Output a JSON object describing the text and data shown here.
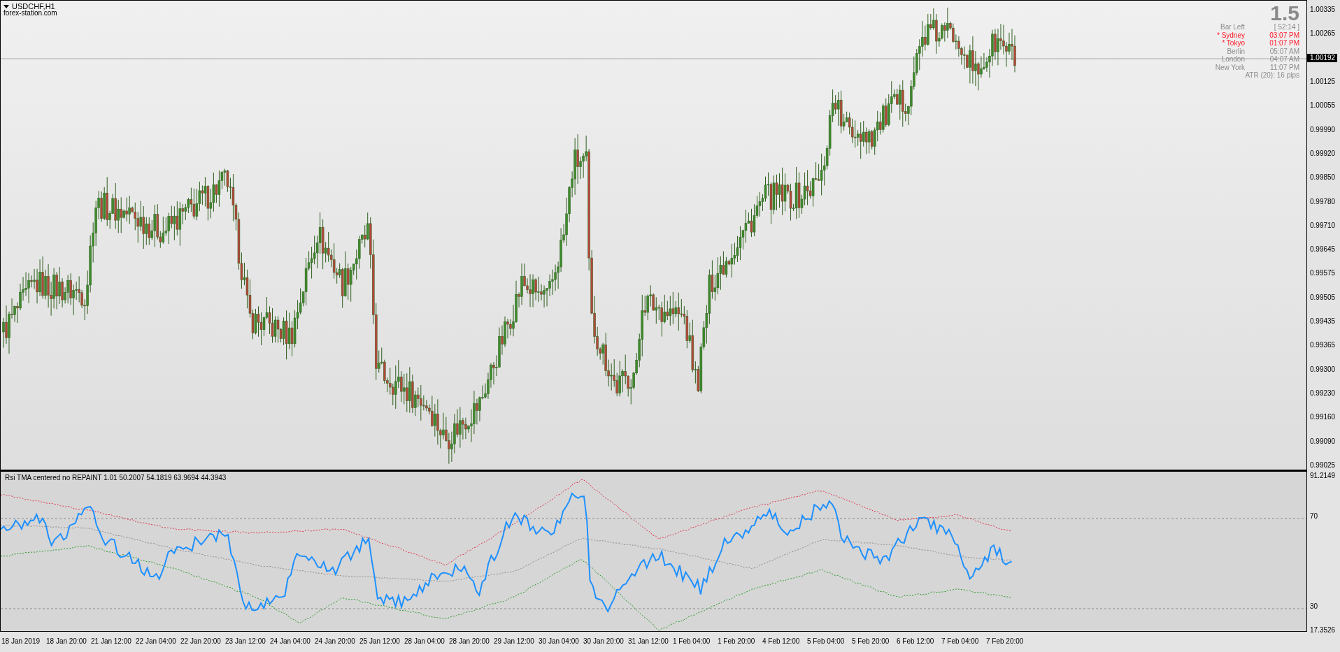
{
  "chart": {
    "symbol": "USDCHF,H1",
    "watermark": "forex-station.com"
  },
  "info_panel": {
    "spread": "1.5",
    "rows": [
      {
        "label": "Bar Left",
        "value": "[ 52:14 ]",
        "highlighted": false
      },
      {
        "label": "* Sydney",
        "value": "03:07 PM",
        "highlighted": true
      },
      {
        "label": "* Tokyo",
        "value": "01:07 PM",
        "highlighted": true
      },
      {
        "label": "Berlin",
        "value": "05:07 AM",
        "highlighted": false
      },
      {
        "label": "London",
        "value": "04:07 AM",
        "highlighted": false
      },
      {
        "label": "New York",
        "value": "11:07 PM",
        "highlighted": false
      }
    ],
    "atr": "ATR (20): 16 pips"
  },
  "price_axis": {
    "labels": [
      "1.00335",
      "1.00265",
      "1.00125",
      "1.00055",
      "0.99990",
      "0.99920",
      "0.99850",
      "0.99780",
      "0.99710",
      "0.99645",
      "0.99575",
      "0.99505",
      "0.99435",
      "0.99365",
      "0.99300",
      "0.99230",
      "0.99160",
      "0.99090",
      "0.99025"
    ],
    "current_price": "1.00192"
  },
  "indicator": {
    "title": "Rsi TMA centered no REPAINT 1.01 50.2007 54.1819 63.9694 44.3943",
    "axis_labels": [
      "91.2149",
      "70",
      "30",
      "17.3526"
    ]
  },
  "time_axis": {
    "labels": [
      "18 Jan 2019",
      "18 Jan 20:00",
      "21 Jan 12:00",
      "22 Jan 04:00",
      "22 Jan 20:00",
      "23 Jan 12:00",
      "24 Jan 04:00",
      "24 Jan 20:00",
      "25 Jan 12:00",
      "28 Jan 04:00",
      "28 Jan 20:00",
      "29 Jan 12:00",
      "30 Jan 04:00",
      "30 Jan 20:00",
      "31 Jan 12:00",
      "1 Feb 04:00",
      "1 Feb 20:00",
      "4 Feb 12:00",
      "5 Feb 04:00",
      "5 Feb 20:00",
      "6 Feb 12:00",
      "7 Feb 04:00",
      "7 Feb 20:00"
    ]
  }
}
